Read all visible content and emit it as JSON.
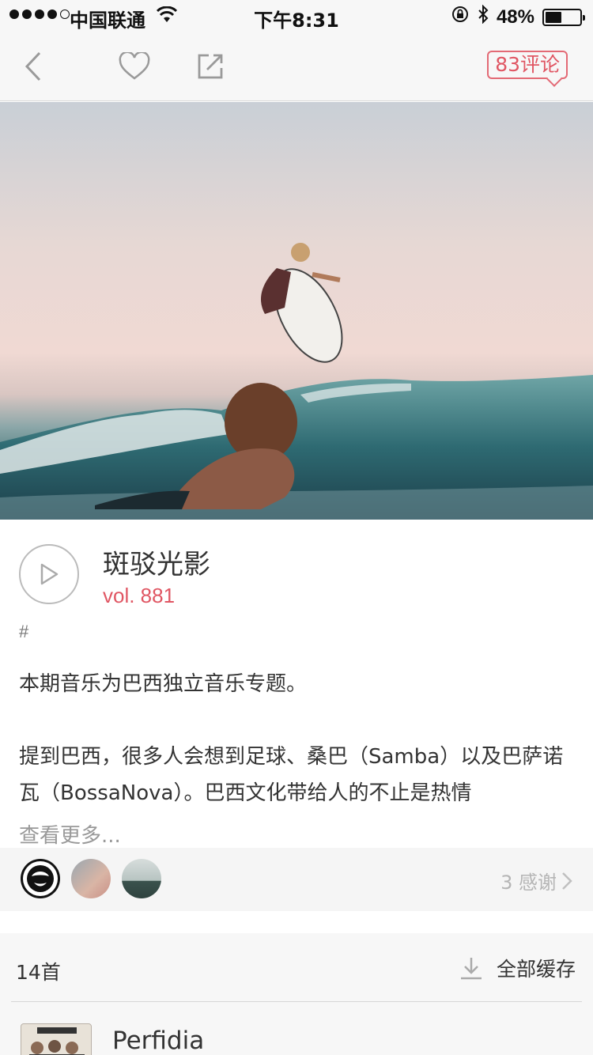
{
  "status_bar": {
    "carrier": "中国联通",
    "time": "下午8:31",
    "battery_text": "48%",
    "battery_level": 0.48
  },
  "nav": {
    "comment_badge": "83评论"
  },
  "episode": {
    "title": "斑驳光影",
    "volume": "vol. 881",
    "tag": "#",
    "description_p1": "本期音乐为巴西独立音乐专题。",
    "description_p2": "提到巴西，很多人会想到足球、桑巴（Samba）以及巴萨诺瓦（BossaNova）。巴西文化带给人的不止是热情",
    "more_link": "查看更多..."
  },
  "thanks": {
    "label": "3 感谢"
  },
  "tracklist": {
    "count_label": "14首",
    "cache_all_label": "全部缓存",
    "tracks": [
      {
        "title": "Perfidia"
      }
    ]
  },
  "icons": {
    "back": "chevron-left-icon",
    "like": "heart-icon",
    "share": "share-icon",
    "play": "play-icon",
    "download": "download-icon",
    "chevron": "chevron-right-icon"
  },
  "colors": {
    "accent": "#e05663",
    "muted": "#b5b5b5"
  }
}
